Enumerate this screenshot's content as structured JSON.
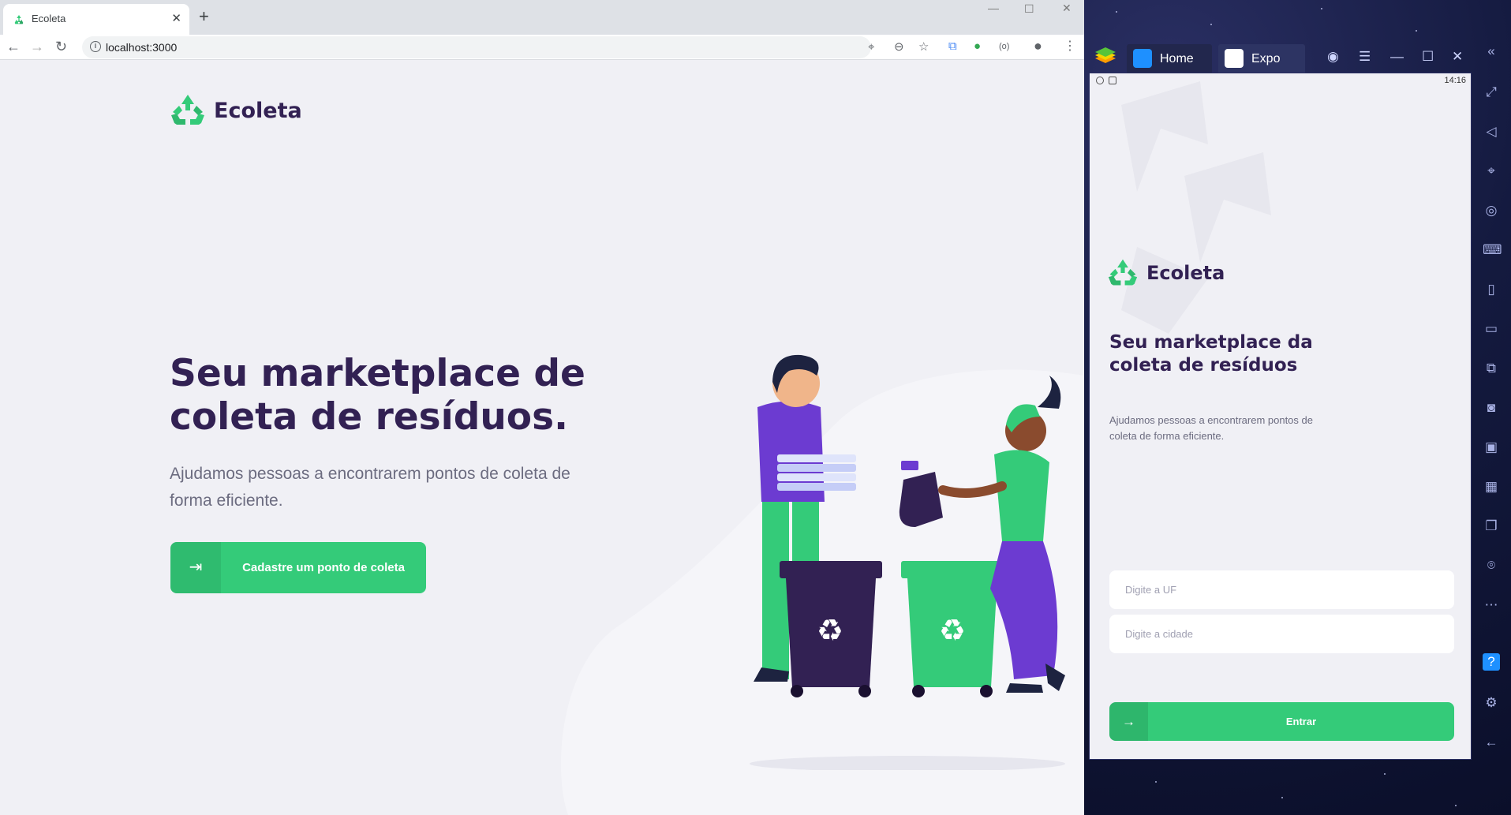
{
  "browser": {
    "tab_title": "Ecoleta",
    "url": "localhost:3000"
  },
  "web": {
    "logo_text": "Ecoleta",
    "hero_title": "Seu marketplace de coleta de resíduos.",
    "hero_text": "Ajudamos pessoas a encontrarem pontos de coleta de forma eficiente.",
    "cta_label": "Cadastre um ponto de coleta"
  },
  "emulator": {
    "tabs": [
      {
        "label": "Home"
      },
      {
        "label": "Expo"
      }
    ]
  },
  "mobile": {
    "status_time": "14:16",
    "logo_text": "Ecoleta",
    "title": "Seu marketplace da coleta de resíduos",
    "text": "Ajudamos pessoas a encontrarem pontos de coleta de forma eficiente.",
    "uf_placeholder": "Digite a UF",
    "city_placeholder": "Digite a cidade",
    "button_label": "Entrar"
  },
  "colors": {
    "brand_green": "#34cb79",
    "title_purple": "#322153",
    "text_gray": "#6c6c80",
    "background": "#f0f0f5"
  }
}
